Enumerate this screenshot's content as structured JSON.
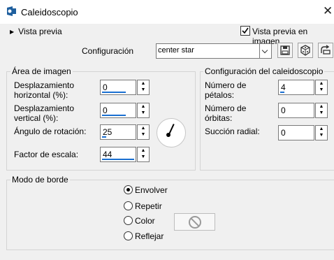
{
  "window": {
    "title": "Caleidoscopio"
  },
  "preview": {
    "toggle_label": "Vista previa",
    "checkbox_label": "Vista previa en imagen",
    "checkbox_checked": true
  },
  "config": {
    "label": "Configuración",
    "preset_value": "center star"
  },
  "area": {
    "title": "Área de imagen",
    "h_offset_label": "Desplazamiento horizontal (%):",
    "h_offset_value": "0",
    "v_offset_label": "Desplazamiento vertical (%):",
    "v_offset_value": "0",
    "rotation_label": "Ángulo de rotación:",
    "rotation_value": "25",
    "scale_label": "Factor de escala:",
    "scale_value": "44"
  },
  "kaleido": {
    "title": "Configuración del caleidoscopio",
    "petals_label": "Número de pétalos:",
    "petals_value": "4",
    "orbits_label": "Número de órbitas:",
    "orbits_value": "0",
    "suction_label": "Succión radial:",
    "suction_value": "0"
  },
  "edge": {
    "title": "Modo de borde",
    "options": [
      "Envolver",
      "Repetir",
      "Color",
      "Reflejar"
    ],
    "selected": "Envolver"
  },
  "colors": {
    "accent": "#1a6fd1"
  }
}
